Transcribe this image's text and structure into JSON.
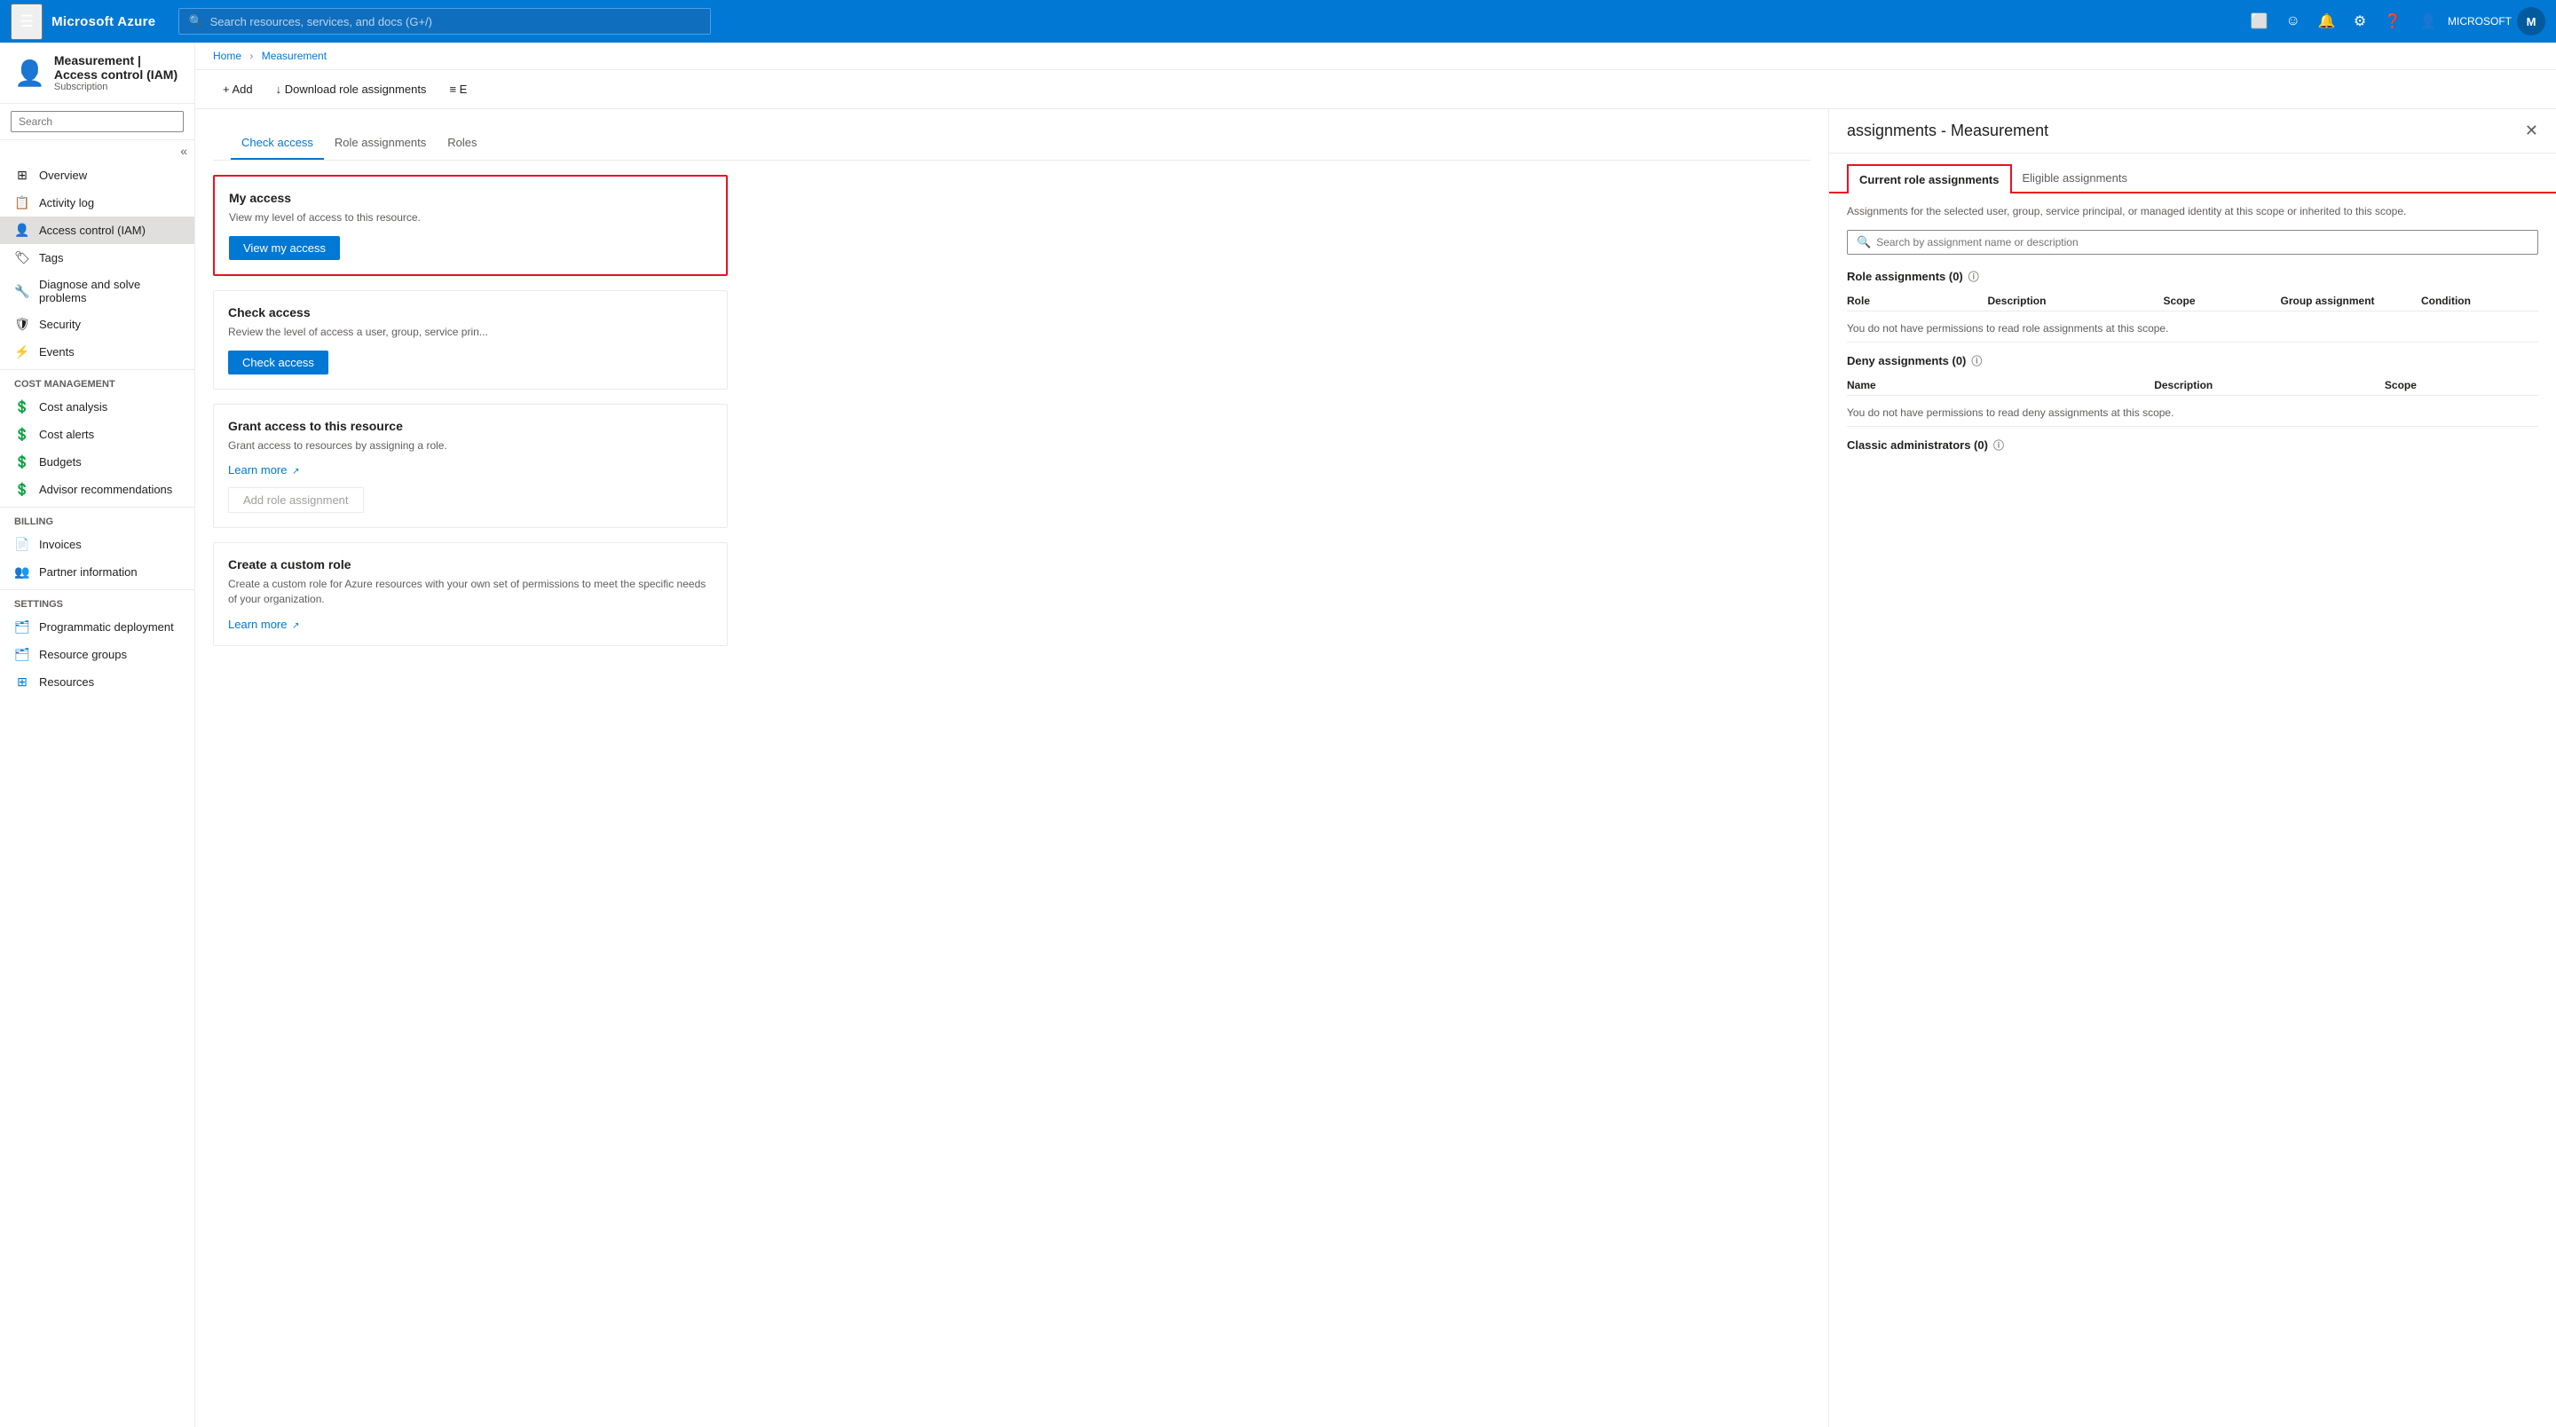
{
  "topnav": {
    "hamburger_label": "☰",
    "logo": "Microsoft Azure",
    "search_placeholder": "Search resources, services, and docs (G+/)",
    "user_label": "MICROSOFT",
    "user_initials": "M"
  },
  "breadcrumb": {
    "home": "Home",
    "measurement": "Measurement"
  },
  "page_header": {
    "title": "Measurement | Access control (IAM)",
    "subtitle": "Subscription"
  },
  "toolbar": {
    "add_label": "+ Add",
    "download_label": "↓ Download role assignments",
    "columns_label": "≡ E"
  },
  "sidebar": {
    "search_placeholder": "Search",
    "collapse_icon": "«",
    "items": [
      {
        "id": "overview",
        "label": "Overview",
        "icon": "⊞"
      },
      {
        "id": "activity-log",
        "label": "Activity log",
        "icon": "📋"
      },
      {
        "id": "access-control",
        "label": "Access control (IAM)",
        "icon": "👤",
        "active": true
      },
      {
        "id": "tags",
        "label": "Tags",
        "icon": "🏷"
      },
      {
        "id": "diagnose",
        "label": "Diagnose and solve problems",
        "icon": "🔧"
      },
      {
        "id": "security",
        "label": "Security",
        "icon": "🛡"
      },
      {
        "id": "events",
        "label": "Events",
        "icon": "⚡"
      }
    ],
    "sections": [
      {
        "label": "Cost Management",
        "items": [
          {
            "id": "cost-analysis",
            "label": "Cost analysis",
            "icon": "💲"
          },
          {
            "id": "cost-alerts",
            "label": "Cost alerts",
            "icon": "💲"
          },
          {
            "id": "budgets",
            "label": "Budgets",
            "icon": "💲"
          },
          {
            "id": "advisor",
            "label": "Advisor recommendations",
            "icon": "💲"
          }
        ]
      },
      {
        "label": "Billing",
        "items": [
          {
            "id": "invoices",
            "label": "Invoices",
            "icon": "📄"
          },
          {
            "id": "partner",
            "label": "Partner information",
            "icon": "👥"
          }
        ]
      },
      {
        "label": "Settings",
        "items": [
          {
            "id": "programmatic",
            "label": "Programmatic deployment",
            "icon": "🗂"
          },
          {
            "id": "resource-groups",
            "label": "Resource groups",
            "icon": "🗂"
          },
          {
            "id": "resources",
            "label": "Resources",
            "icon": "⊞"
          }
        ]
      }
    ]
  },
  "iam_tabs": [
    {
      "id": "check-access",
      "label": "Check access",
      "active": true
    },
    {
      "id": "role-assignments",
      "label": "Role assignments"
    },
    {
      "id": "roles",
      "label": "Roles"
    }
  ],
  "my_access_card": {
    "title": "My access",
    "description": "View my level of access to this resource.",
    "button_label": "View my access",
    "highlighted": true
  },
  "check_access_card": {
    "title": "Check access",
    "description": "Review the level of access a user, group, service prin...",
    "button_label": "Check access"
  },
  "grant_access_card": {
    "title": "Grant access to this resource",
    "description": "Grant access to resources by assigning a role.",
    "learn_more_label": "Learn more",
    "button_label": "Add role assignment",
    "button_disabled": true
  },
  "custom_role_card": {
    "title": "Create a custom role",
    "description": "Create a custom role for Azure resources with your own set of permissions to meet the specific needs of your organization.",
    "learn_more_label": "Learn more"
  },
  "panel": {
    "title": "assignments - Measurement",
    "close_icon": "✕",
    "tabs": [
      {
        "id": "current",
        "label": "Current role assignments",
        "active": true
      },
      {
        "id": "eligible",
        "label": "Eligible assignments"
      }
    ],
    "description": "Assignments for the selected user, group, service principal, or managed identity at this scope or inherited to this scope.",
    "search_placeholder": "Search by assignment name or description",
    "role_assignments": {
      "label": "Role assignments (0)",
      "columns": [
        "Role",
        "Description",
        "Scope",
        "Group assignment",
        "Condition"
      ],
      "no_permission_msg": "You do not have permissions to read role assignments at this scope."
    },
    "deny_assignments": {
      "label": "Deny assignments (0)",
      "columns": [
        "Name",
        "Description",
        "Scope"
      ],
      "no_permission_msg": "You do not have permissions to read deny assignments at this scope."
    },
    "classic_admins": {
      "label": "Classic administrators (0)"
    }
  }
}
